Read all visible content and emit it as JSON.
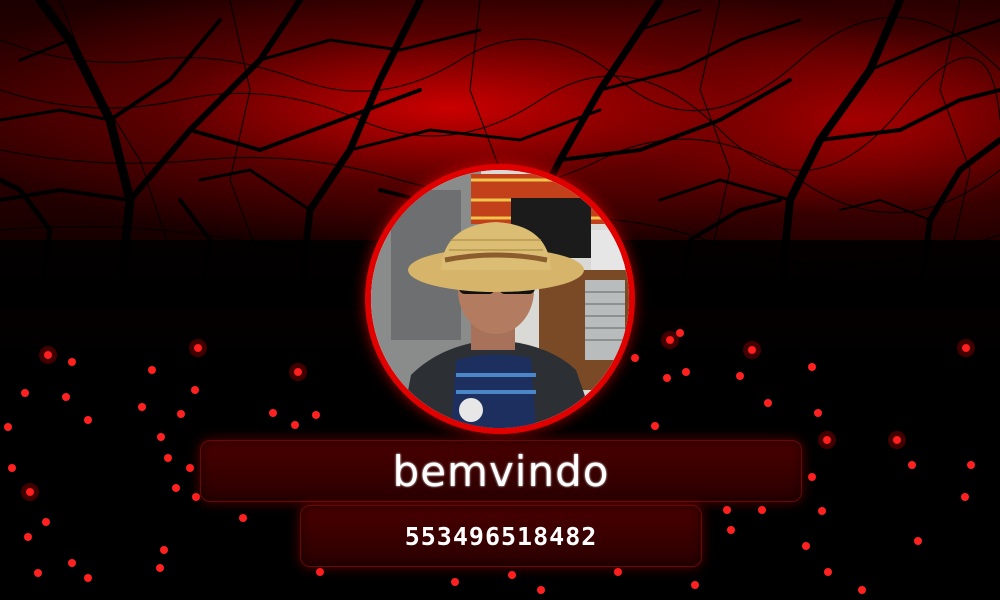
{
  "welcome": {
    "label": "bemvindo"
  },
  "phone": {
    "number": "553496518482"
  },
  "avatar": {
    "description_icon": "profile-photo"
  },
  "colors": {
    "accent": "#e00000",
    "bar": "#3a0000",
    "glow": "#ff1a1a"
  }
}
